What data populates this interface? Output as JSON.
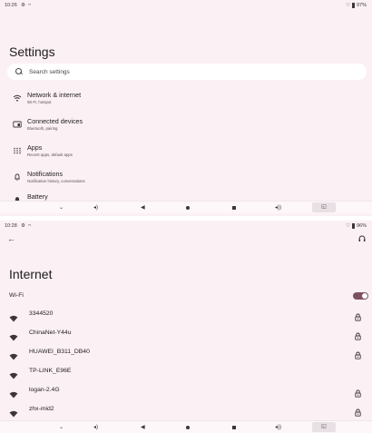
{
  "top": {
    "status": {
      "time": "10:26",
      "battery": "97%"
    },
    "title": "Settings",
    "search": {
      "placeholder": "Search settings"
    },
    "items": [
      {
        "label": "Network & internet",
        "sub": "Wi-Fi, hotspot",
        "icon": "wifi-icon"
      },
      {
        "label": "Connected devices",
        "sub": "Bluetooth, pairing",
        "icon": "devices-icon"
      },
      {
        "label": "Apps",
        "sub": "Recent apps, default apps",
        "icon": "apps-grid-icon"
      },
      {
        "label": "Notifications",
        "sub": "Notification history, conversations",
        "icon": "bell-icon"
      },
      {
        "label": "Battery",
        "sub": "",
        "icon": "battery-icon"
      }
    ]
  },
  "bottom": {
    "status": {
      "time": "10:28",
      "battery": "96%"
    },
    "title": "Internet",
    "wifi_label": "Wi-Fi",
    "wifi_on": true,
    "networks": [
      {
        "name": "3344520",
        "locked": true
      },
      {
        "name": "ChinaNet-Y44u",
        "locked": true
      },
      {
        "name": "HUAWEI_B311_DB40",
        "locked": true
      },
      {
        "name": "TP-LINK_E96E",
        "locked": false
      },
      {
        "name": "logan-2.4G",
        "locked": true
      },
      {
        "name": "zhx-mid2",
        "locked": true
      }
    ]
  },
  "colors": {
    "background": "#fbf1f4",
    "accent": "#7d5260"
  }
}
